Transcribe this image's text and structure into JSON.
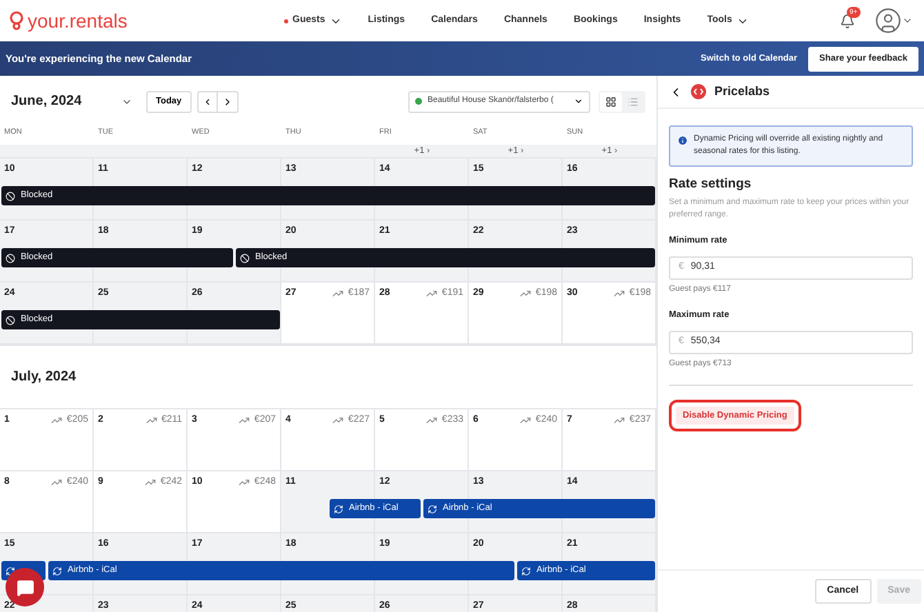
{
  "brand": {
    "name": "your.rentals"
  },
  "nav": [
    {
      "label": "Guests",
      "dot": true,
      "dropdown": true
    },
    {
      "label": "Listings",
      "dot": false,
      "dropdown": false
    },
    {
      "label": "Calendars",
      "dot": false,
      "dropdown": false
    },
    {
      "label": "Channels",
      "dot": false,
      "dropdown": false
    },
    {
      "label": "Bookings",
      "dot": false,
      "dropdown": false
    },
    {
      "label": "Insights",
      "dot": false,
      "dropdown": false
    },
    {
      "label": "Tools",
      "dot": false,
      "dropdown": true
    }
  ],
  "notifications": {
    "badge": "9+"
  },
  "banner": {
    "text": "You're experiencing the new Calendar",
    "link": "Switch to old Calendar",
    "button": "Share your feedback"
  },
  "toolbar": {
    "month": "June, 2024",
    "today": "Today",
    "listing": "Beautiful House Skanör/falsterbo (",
    "views": [
      {
        "kind": "grid",
        "selected": true
      },
      {
        "kind": "list",
        "selected": false
      }
    ]
  },
  "weekdays": [
    "MON",
    "TUE",
    "WED",
    "THU",
    "FRI",
    "SAT",
    "SUN"
  ],
  "overflow_row": [
    "+1 ›",
    "+1 ›",
    "+1 ›"
  ],
  "months": [
    {
      "weeks": [
        {
          "days": [
            {
              "day": "10",
              "shaded": true
            },
            {
              "day": "11",
              "shaded": true
            },
            {
              "day": "12",
              "shaded": true
            },
            {
              "day": "13",
              "shaded": true
            },
            {
              "day": "14",
              "shaded": true
            },
            {
              "day": "15",
              "shaded": true
            },
            {
              "day": "16",
              "shaded": true
            }
          ],
          "bars": [
            {
              "kind": "blocked",
              "label": "Blocked"
            }
          ]
        },
        {
          "days": [
            {
              "day": "17",
              "shaded": true
            },
            {
              "day": "18",
              "shaded": true
            },
            {
              "day": "19",
              "shaded": true
            },
            {
              "day": "20",
              "shaded": true
            },
            {
              "day": "21",
              "shaded": true
            },
            {
              "day": "22",
              "shaded": true
            },
            {
              "day": "23",
              "shaded": true
            }
          ],
          "bars": [
            {
              "kind": "blocked",
              "label": "Blocked"
            },
            {
              "kind": "blocked",
              "label": "Blocked"
            }
          ]
        },
        {
          "days": [
            {
              "day": "24",
              "shaded": true
            },
            {
              "day": "25",
              "shaded": true
            },
            {
              "day": "26",
              "shaded": true
            },
            {
              "day": "27",
              "shaded": false,
              "price": "€187"
            },
            {
              "day": "28",
              "shaded": false,
              "price": "€191"
            },
            {
              "day": "29",
              "shaded": false,
              "price": "€198"
            },
            {
              "day": "30",
              "shaded": false,
              "price": "€198"
            }
          ],
          "bars": [
            {
              "kind": "blocked",
              "label": "Blocked"
            }
          ]
        }
      ]
    },
    {
      "title": "July, 2024",
      "weeks": [
        {
          "days": [
            {
              "day": "1",
              "shaded": false,
              "price": "€205"
            },
            {
              "day": "2",
              "shaded": false,
              "price": "€211"
            },
            {
              "day": "3",
              "shaded": false,
              "price": "€207"
            },
            {
              "day": "4",
              "shaded": false,
              "price": "€227"
            },
            {
              "day": "5",
              "shaded": false,
              "price": "€233"
            },
            {
              "day": "6",
              "shaded": false,
              "price": "€240"
            },
            {
              "day": "7",
              "shaded": false,
              "price": "€237"
            }
          ]
        },
        {
          "days": [
            {
              "day": "8",
              "shaded": false,
              "price": "€240"
            },
            {
              "day": "9",
              "shaded": false,
              "price": "€242"
            },
            {
              "day": "10",
              "shaded": false,
              "price": "€248"
            },
            {
              "day": "11",
              "shaded": true
            },
            {
              "day": "12",
              "shaded": true
            },
            {
              "day": "13",
              "shaded": true
            },
            {
              "day": "14",
              "shaded": true
            }
          ],
          "bars": [
            {
              "kind": "ical",
              "label": "Airbnb - iCal"
            },
            {
              "kind": "ical",
              "label": "Airbnb - iCal"
            }
          ]
        },
        {
          "days": [
            {
              "day": "15",
              "shaded": true
            },
            {
              "day": "16",
              "shaded": true
            },
            {
              "day": "17",
              "shaded": true
            },
            {
              "day": "18",
              "shaded": true
            },
            {
              "day": "19",
              "shaded": true
            },
            {
              "day": "20",
              "shaded": true
            },
            {
              "day": "21",
              "shaded": true
            }
          ],
          "bars": [
            {
              "kind": "ical"
            },
            {
              "kind": "ical",
              "label": "Airbnb - iCal"
            },
            {
              "kind": "ical",
              "label": "Airbnb - iCal"
            }
          ]
        },
        {
          "days": [
            {
              "day": "22",
              "shaded": true
            },
            {
              "day": "23",
              "shaded": true
            },
            {
              "day": "24",
              "shaded": true
            },
            {
              "day": "25",
              "shaded": true
            },
            {
              "day": "26",
              "shaded": true
            },
            {
              "day": "27",
              "shaded": true
            },
            {
              "day": "28",
              "shaded": true
            }
          ]
        }
      ]
    }
  ],
  "panel": {
    "title": "Pricelabs",
    "info": "Dynamic Pricing will override all existing nightly and seasonal rates for this listing.",
    "heading": "Rate settings",
    "description": "Set a minimum and maximum rate to keep your prices within your preferred range.",
    "fields": [
      {
        "label": "Minimum rate",
        "currency": "€",
        "value": "90,31",
        "note": "Guest pays €117"
      },
      {
        "label": "Maximum rate",
        "currency": "€",
        "value": "550,34",
        "note": "Guest pays €713"
      }
    ],
    "disable_button": "Disable Dynamic Pricing",
    "highlighted": true,
    "buttons": [
      {
        "label": "Cancel",
        "disabled": false
      },
      {
        "label": "Save",
        "disabled": true
      }
    ]
  }
}
